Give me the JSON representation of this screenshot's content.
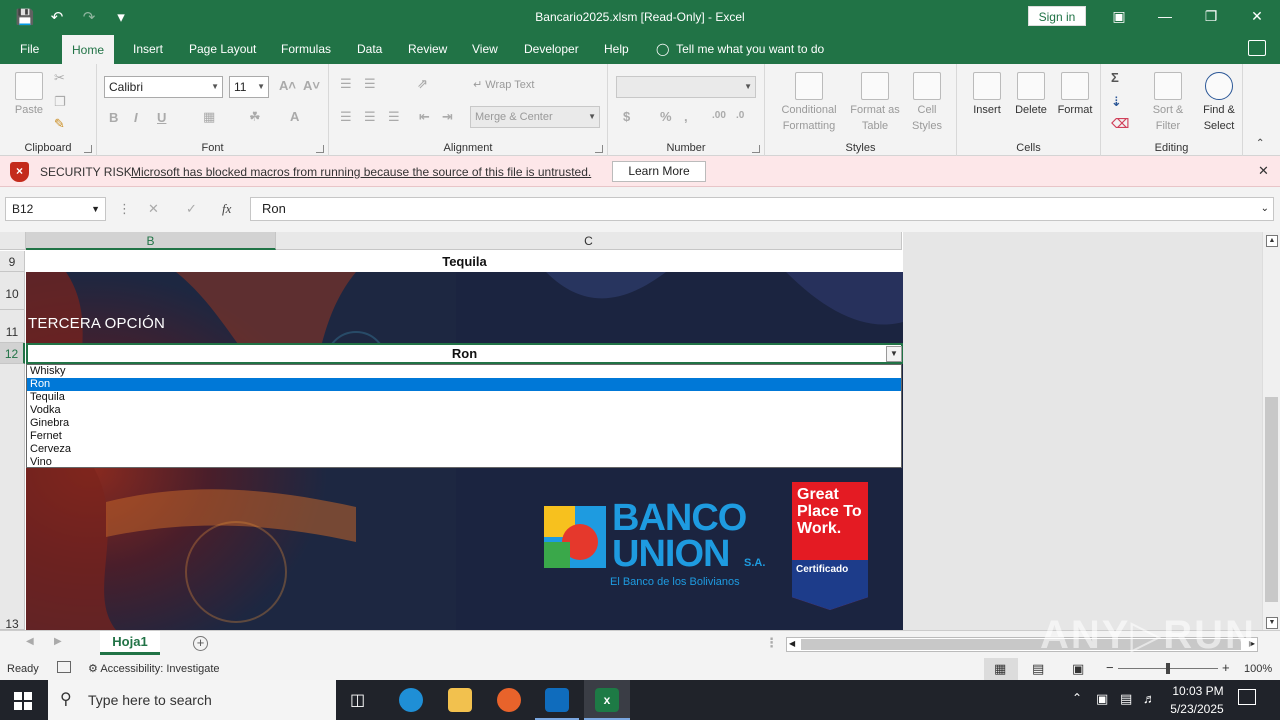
{
  "titlebar": {
    "title": "Bancario2025.xlsm  [Read-Only]  -  Excel",
    "sign_in": "Sign in"
  },
  "menu": {
    "tabs": [
      "File",
      "Home",
      "Insert",
      "Page Layout",
      "Formulas",
      "Data",
      "Review",
      "View",
      "Developer",
      "Help"
    ],
    "tell_me": "Tell me what you want to do"
  },
  "ribbon": {
    "clipboard": {
      "label": "Clipboard",
      "paste": "Paste"
    },
    "font": {
      "label": "Font",
      "family": "Calibri",
      "size": "11",
      "bold": "B",
      "italic": "I",
      "underline": "U"
    },
    "alignment": {
      "label": "Alignment",
      "wrap": "Wrap Text",
      "merge": "Merge & Center"
    },
    "number": {
      "label": "Number",
      "format": ""
    },
    "styles": {
      "label": "Styles",
      "conditional": "Conditional Formatting",
      "format_as_table": "Format as Table",
      "cell_styles": "Cell Styles"
    },
    "cells": {
      "label": "Cells",
      "insert": "Insert",
      "delete": "Delete",
      "format": "Format"
    },
    "editing": {
      "label": "Editing",
      "sort": "Sort & Filter",
      "find": "Find & Select"
    }
  },
  "security": {
    "title": "SECURITY RISK",
    "message": "Microsoft has blocked macros from running because the source of this file is untrusted.",
    "learn_more": "Learn More"
  },
  "formula_bar": {
    "name_box": "B12",
    "fx": "fx",
    "value": "Ron"
  },
  "grid": {
    "columns": [
      "B",
      "C"
    ],
    "rows": [
      "9",
      "10",
      "11",
      "12",
      "13"
    ],
    "cell_c9": "Tequila",
    "label_row11": "TERCERA OPCIÓN",
    "cell_b12": "Ron",
    "dropdown": {
      "items": [
        "Whisky",
        "Ron",
        "Tequila",
        "Vodka",
        "Ginebra",
        "Fernet",
        "Cerveza",
        "Vino"
      ],
      "selected_index": 1
    },
    "bank_logo": {
      "name_line1": "BANCO",
      "name_line2": "UNION",
      "suffix": "S.A.",
      "tagline": "El Banco de los Bolivianos"
    },
    "badge": {
      "text": "Great Place To Work.",
      "cert": "Certificado"
    }
  },
  "sheets": {
    "tabs": [
      "Hoja1"
    ]
  },
  "status": {
    "ready": "Ready",
    "accessibility": "Accessibility: Investigate",
    "zoom": "100%"
  },
  "taskbar": {
    "search_placeholder": "Type here to search",
    "time": "10:03 PM",
    "date": "5/23/2025"
  },
  "colors": {
    "excel_green": "#217346",
    "security_bg": "#fde7e9",
    "selection_blue": "#0078d7"
  }
}
